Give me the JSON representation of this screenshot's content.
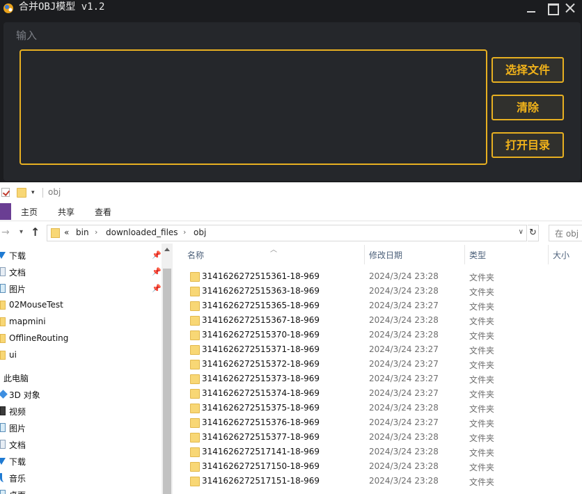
{
  "app": {
    "title": "合并OBJ模型 v1.2",
    "input_label": "输入",
    "input_value": "",
    "buttons": {
      "select_files": "选择文件",
      "clear": "清除",
      "open_dir": "打开目录"
    },
    "colors": {
      "accent": "#f3b41a",
      "background": "#1b1c1f",
      "panel": "#25272b"
    }
  },
  "explorer": {
    "quick_access_title": "obj",
    "ribbon_tabs": [
      "主页",
      "共享",
      "查看"
    ],
    "breadcrumb": {
      "prefix": "«",
      "parts": [
        "bin",
        "downloaded_files",
        "obj"
      ]
    },
    "search_placeholder": "在 obj",
    "nav_pinned": [
      {
        "label": "下载",
        "icon": "download-icon"
      },
      {
        "label": "文档",
        "icon": "document-icon"
      },
      {
        "label": "图片",
        "icon": "picture-icon"
      }
    ],
    "nav_folders": [
      "02MouseTest",
      "mapmini",
      "OfflineRouting",
      "ui"
    ],
    "nav_pc_label": "此电脑",
    "nav_pc_items": [
      {
        "label": "3D 对象",
        "icon": "3d-objects-icon"
      },
      {
        "label": "视频",
        "icon": "video-icon"
      },
      {
        "label": "图片",
        "icon": "picture-icon"
      },
      {
        "label": "文档",
        "icon": "document-icon"
      },
      {
        "label": "下载",
        "icon": "download-icon"
      },
      {
        "label": "音乐",
        "icon": "music-icon"
      },
      {
        "label": "桌面",
        "icon": "desktop-icon"
      }
    ],
    "columns": [
      "名称",
      "修改日期",
      "类型",
      "大小"
    ],
    "files": [
      {
        "name": "3141626272515361-18-969",
        "date": "2024/3/24 23:28",
        "type": "文件夹"
      },
      {
        "name": "3141626272515363-18-969",
        "date": "2024/3/24 23:28",
        "type": "文件夹"
      },
      {
        "name": "3141626272515365-18-969",
        "date": "2024/3/24 23:27",
        "type": "文件夹"
      },
      {
        "name": "3141626272515367-18-969",
        "date": "2024/3/24 23:28",
        "type": "文件夹"
      },
      {
        "name": "3141626272515370-18-969",
        "date": "2024/3/24 23:28",
        "type": "文件夹"
      },
      {
        "name": "3141626272515371-18-969",
        "date": "2024/3/24 23:27",
        "type": "文件夹"
      },
      {
        "name": "3141626272515372-18-969",
        "date": "2024/3/24 23:27",
        "type": "文件夹"
      },
      {
        "name": "3141626272515373-18-969",
        "date": "2024/3/24 23:27",
        "type": "文件夹"
      },
      {
        "name": "3141626272515374-18-969",
        "date": "2024/3/24 23:27",
        "type": "文件夹"
      },
      {
        "name": "3141626272515375-18-969",
        "date": "2024/3/24 23:28",
        "type": "文件夹"
      },
      {
        "name": "3141626272515376-18-969",
        "date": "2024/3/24 23:27",
        "type": "文件夹"
      },
      {
        "name": "3141626272515377-18-969",
        "date": "2024/3/24 23:28",
        "type": "文件夹"
      },
      {
        "name": "3141626272517141-18-969",
        "date": "2024/3/24 23:28",
        "type": "文件夹"
      },
      {
        "name": "3141626272517150-18-969",
        "date": "2024/3/24 23:28",
        "type": "文件夹"
      },
      {
        "name": "3141626272517151-18-969",
        "date": "2024/3/24 23:28",
        "type": "文件夹"
      }
    ]
  }
}
